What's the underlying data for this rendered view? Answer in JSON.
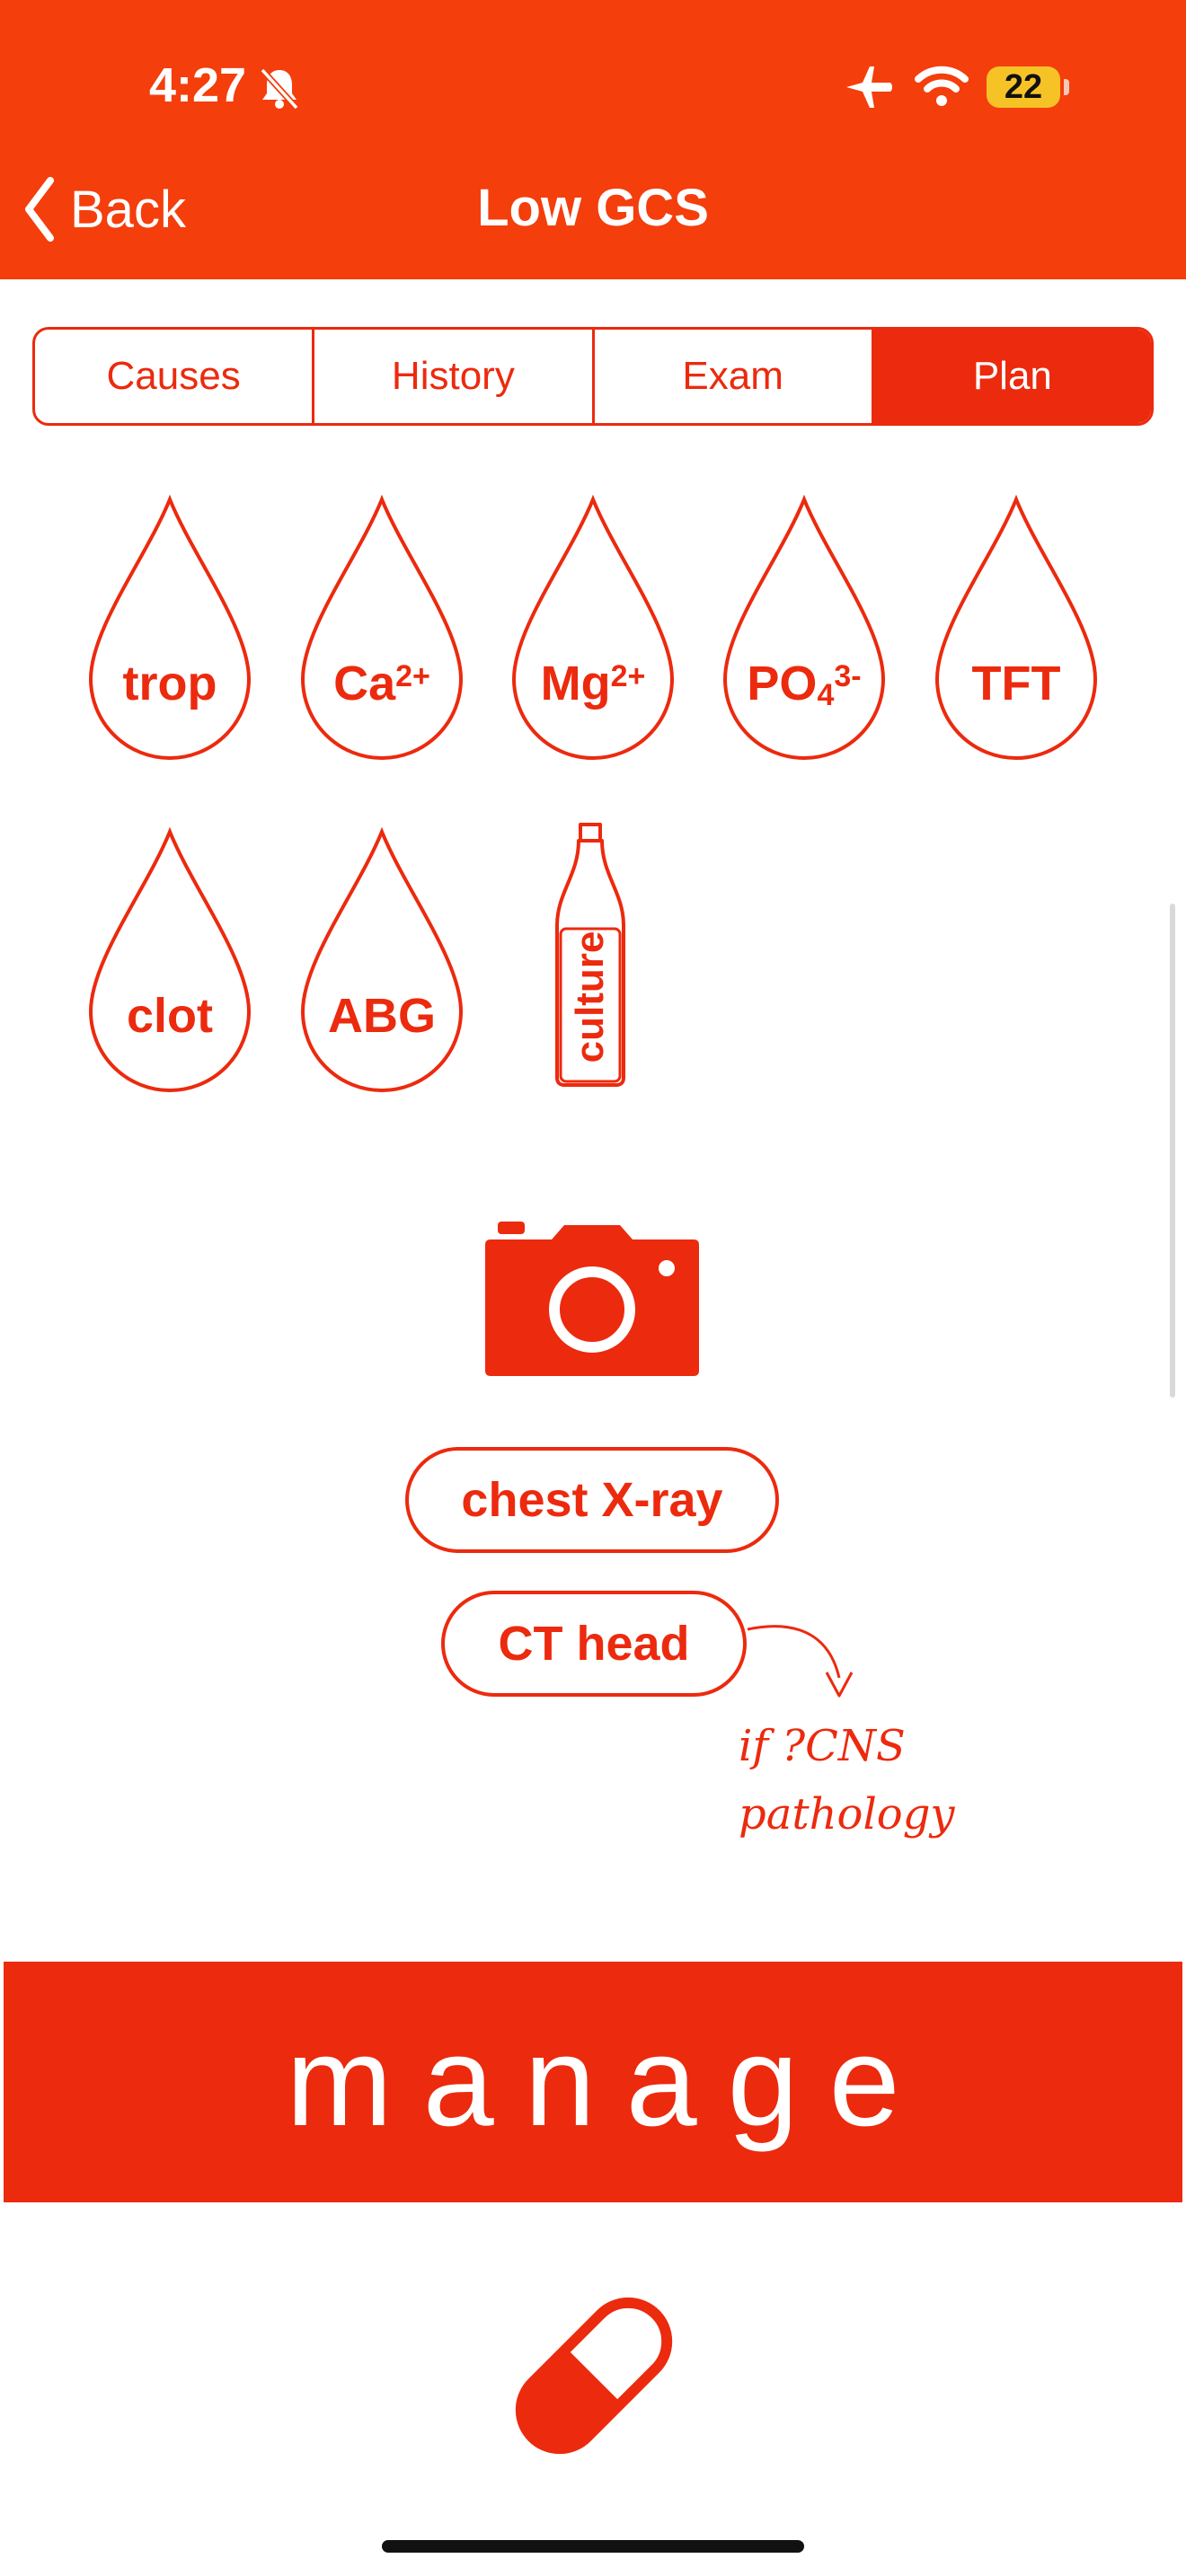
{
  "status_bar": {
    "time": "4:27",
    "battery": "22"
  },
  "nav": {
    "back_label": "Back",
    "title": "Low GCS"
  },
  "tabs": [
    {
      "label": "Causes",
      "active": false
    },
    {
      "label": "History",
      "active": false
    },
    {
      "label": "Exam",
      "active": false
    },
    {
      "label": "Plan",
      "active": true
    }
  ],
  "blood_tests": {
    "trop": "trop",
    "ca_base": "Ca",
    "ca_sup": "2+",
    "mg_base": "Mg",
    "mg_sup": "2+",
    "po_base": "PO",
    "po_sub": "4",
    "po_sup": "3-",
    "tft": "TFT",
    "clot": "clot",
    "abg": "ABG",
    "culture": "culture"
  },
  "imaging": {
    "chest_xray": "chest X-ray",
    "ct_head": "CT head",
    "ct_note_line1": "if ?CNS",
    "ct_note_line2": "pathology"
  },
  "manage": {
    "label": "manage"
  },
  "colors": {
    "header": "#f43e0c",
    "accent": "#ec2a0e"
  },
  "icons": [
    "chevron-left-icon",
    "bell-slash-icon",
    "airplane-icon",
    "wifi-icon",
    "camera-icon",
    "capsule-icon",
    "blood-drop-icon",
    "culture-bottle-icon"
  ]
}
